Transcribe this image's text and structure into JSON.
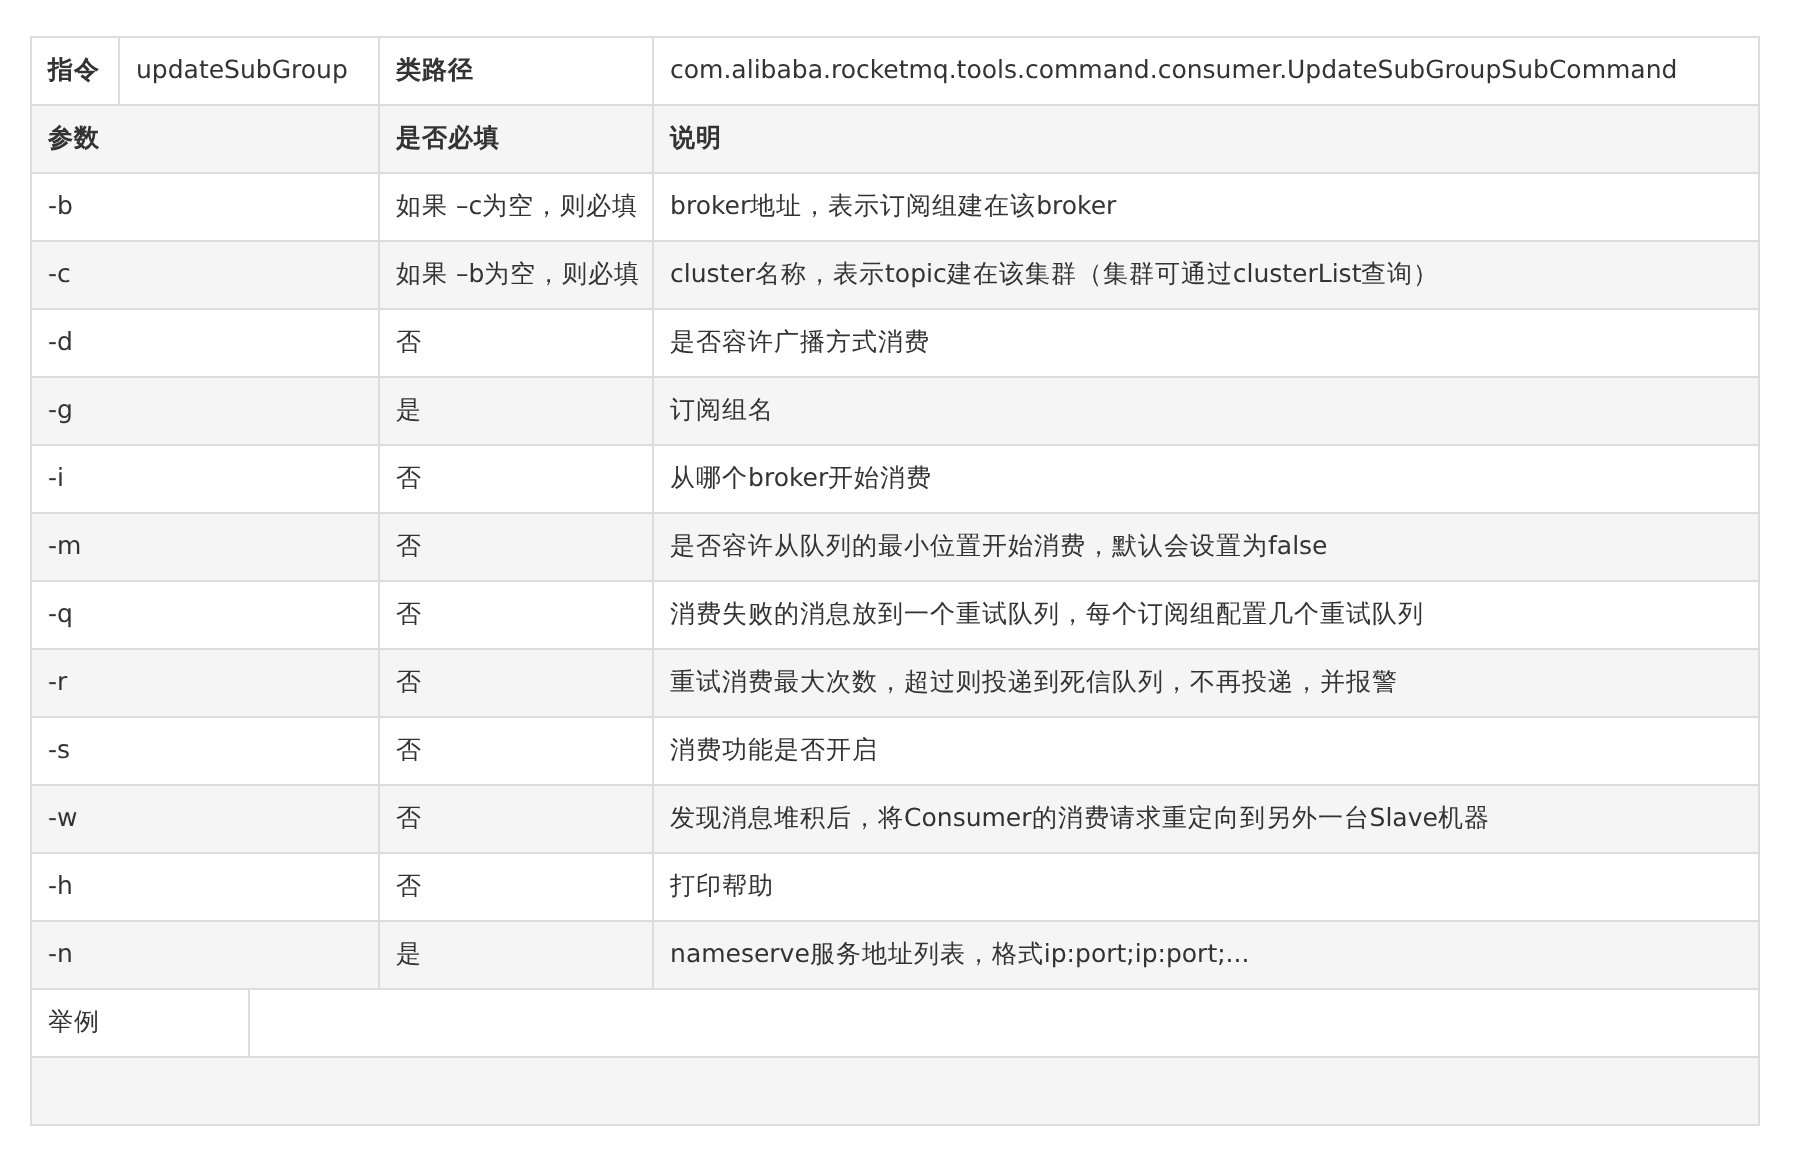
{
  "command_row": {
    "command_label": "指令",
    "command": "updateSubGroup",
    "class_path_label": "类路径",
    "class_path": "com.alibaba.rocketmq.tools.command.consumer.UpdateSubGroupSubCommand"
  },
  "columns": [
    "参数",
    "是否必填",
    "说明"
  ],
  "rows": [
    {
      "param": "-b",
      "required": "如果 –c为空，则必填",
      "description": "broker地址，表示订阅组建在该broker"
    },
    {
      "param": "-c",
      "required": "如果 –b为空，则必填",
      "description": "cluster名称，表示topic建在该集群（集群可通过clusterList查询）"
    },
    {
      "param": "-d",
      "required": "否",
      "description": "是否容许广播方式消费"
    },
    {
      "param": "-g",
      "required": "是",
      "description": "订阅组名"
    },
    {
      "param": "-i",
      "required": "否",
      "description": "从哪个broker开始消费"
    },
    {
      "param": "-m",
      "required": "否",
      "description": "是否容许从队列的最小位置开始消费，默认会设置为false"
    },
    {
      "param": "-q",
      "required": "否",
      "description": "消费失败的消息放到一个重试队列，每个订阅组配置几个重试队列"
    },
    {
      "param": "-r",
      "required": "否",
      "description": "重试消费最大次数，超过则投递到死信队列，不再投递，并报警"
    },
    {
      "param": "-s",
      "required": "否",
      "description": "消费功能是否开启"
    },
    {
      "param": "-w",
      "required": "否",
      "description": "发现消息堆积后，将Consumer的消费请求重定向到另外一台Slave机器"
    },
    {
      "param": "-h",
      "required": "否",
      "description": "打印帮助"
    },
    {
      "param": "-n",
      "required": "是",
      "description": "nameserve服务地址列表，格式ip:port;ip:port;..."
    }
  ],
  "example_label": "举例"
}
